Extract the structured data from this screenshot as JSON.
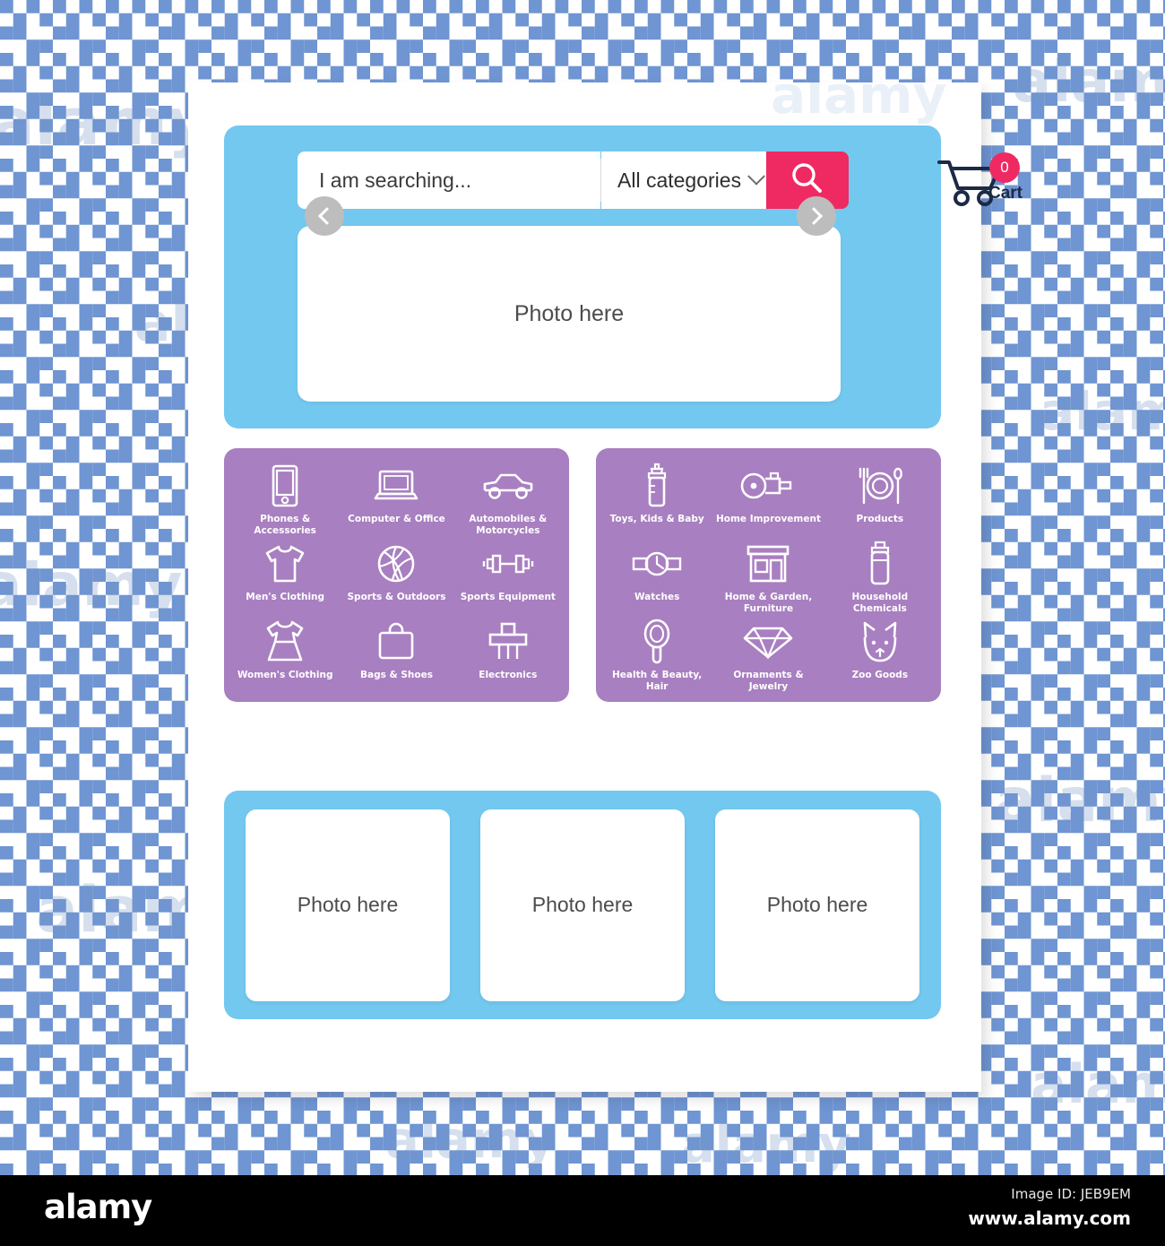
{
  "background": {
    "pattern_blue": "#6f95d2",
    "pattern_white": "#ffffff",
    "watermark_text": "alamy"
  },
  "theme": {
    "panel_blue": "#73c8ef",
    "panel_purple": "#a87fc0",
    "accent_pink": "#ef2a63",
    "card_white": "#ffffff",
    "arrow_gray": "#bdbdbd",
    "text_dark": "#3a3a3a"
  },
  "header": {
    "search": {
      "placeholder": "I am searching...",
      "value": ""
    },
    "category_dropdown": {
      "selected": "All categories",
      "chevron_icon": "chevron-down-icon"
    },
    "search_button": {
      "icon": "search-icon",
      "label": "Search"
    },
    "cart": {
      "icon": "shopping-cart-icon",
      "count": "0",
      "label": "Cart"
    }
  },
  "carousel": {
    "slide_text": "Photo here",
    "prev_icon": "chevron-left-icon",
    "next_icon": "chevron-right-icon"
  },
  "categories": {
    "left_panel": [
      {
        "label": "Phones & Accessories",
        "icon": "smartphone-icon"
      },
      {
        "label": "Computer & Office",
        "icon": "laptop-icon"
      },
      {
        "label": "Automobiles & Motorcycles",
        "icon": "car-icon"
      },
      {
        "label": "Men's Clothing",
        "icon": "tshirt-icon"
      },
      {
        "label": "Sports & Outdoors",
        "icon": "ball-of-yarn-icon"
      },
      {
        "label": "Sports Equipment",
        "icon": "dumbbell-icon"
      },
      {
        "label": "Women's Clothing",
        "icon": "dress-icon"
      },
      {
        "label": "Bags & Shoes",
        "icon": "briefcase-icon"
      },
      {
        "label": "Electronics",
        "icon": "shredder-icon"
      }
    ],
    "right_panel": [
      {
        "label": "Toys, Kids & Baby",
        "icon": "baby-bottle-icon"
      },
      {
        "label": "Home Improvement",
        "icon": "power-tool-icon"
      },
      {
        "label": "Products",
        "icon": "plate-cutlery-icon"
      },
      {
        "label": "Watches",
        "icon": "wristwatch-icon"
      },
      {
        "label": "Home & Garden, Furniture",
        "icon": "storefront-icon"
      },
      {
        "label": "Household Chemicals",
        "icon": "spray-bottle-icon"
      },
      {
        "label": "Health & Beauty, Hair",
        "icon": "hand-mirror-icon"
      },
      {
        "label": "Ornaments & Jewelry",
        "icon": "diamond-icon"
      },
      {
        "label": "Zoo Goods",
        "icon": "cat-face-icon"
      }
    ]
  },
  "promo_cards": [
    {
      "text": "Photo here"
    },
    {
      "text": "Photo here"
    },
    {
      "text": "Photo here"
    }
  ],
  "footer": {
    "logo": "alamy",
    "image_id": "Image ID: JEB9EM",
    "url": "www.alamy.com"
  }
}
